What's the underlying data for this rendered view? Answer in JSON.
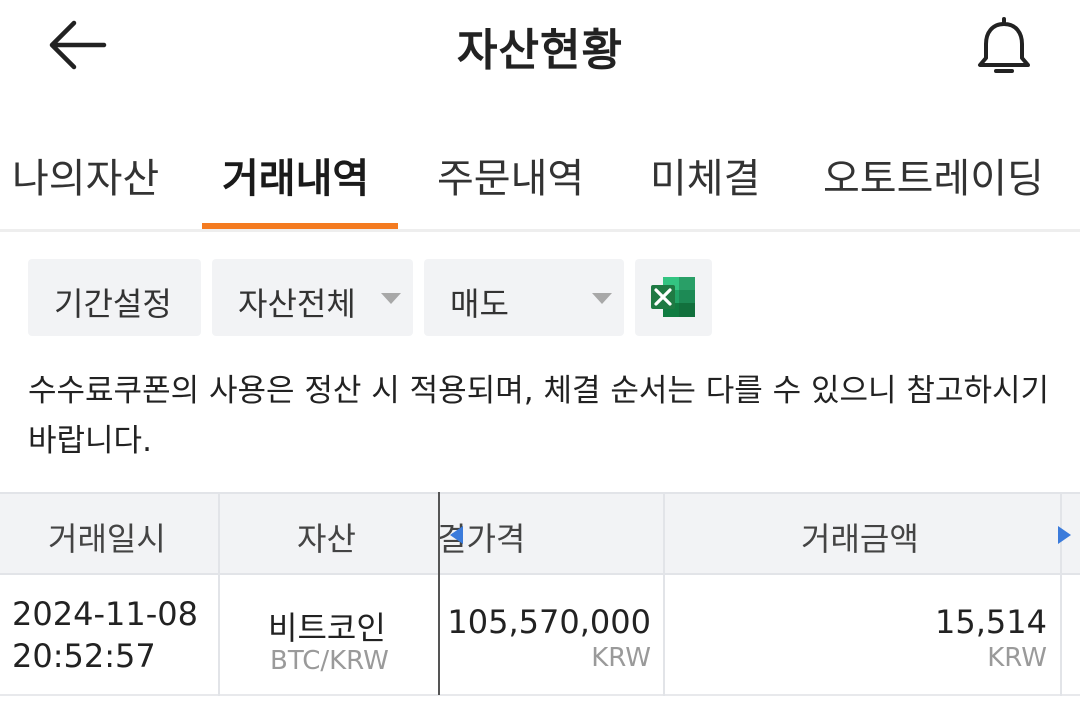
{
  "header": {
    "title": "자산현황",
    "back_icon": "arrow-left-icon",
    "bell_icon": "bell-icon"
  },
  "tabs": [
    {
      "label": "나의자산",
      "active": false
    },
    {
      "label": "거래내역",
      "active": true
    },
    {
      "label": "주문내역",
      "active": false
    },
    {
      "label": "미체결",
      "active": false
    },
    {
      "label": "오토트레이딩",
      "active": false
    }
  ],
  "filters": {
    "period_label": "기간설정",
    "asset_select": "자산전체",
    "type_select": "매도",
    "excel_icon": "excel-icon"
  },
  "notice": "수수료쿠폰의 사용은 정산 시 적용되며, 체결 순서는 다를 수 있으니 참고하시기 바랍니다.",
  "table": {
    "headers": {
      "datetime": "거래일시",
      "asset": "자산",
      "price": "결가격",
      "amount": "거래금액"
    },
    "rows": [
      {
        "date": "2024-11-08",
        "time": "20:52:57",
        "asset_name": "비트코인",
        "pair": "BTC/KRW",
        "price": "105,570,000",
        "price_unit": "KRW",
        "amount": "15,514",
        "amount_unit": "KRW"
      }
    ]
  },
  "colors": {
    "accent": "#f47b20",
    "scroll_arrow": "#3b7bdb",
    "excel_green": "#1f7a43"
  }
}
